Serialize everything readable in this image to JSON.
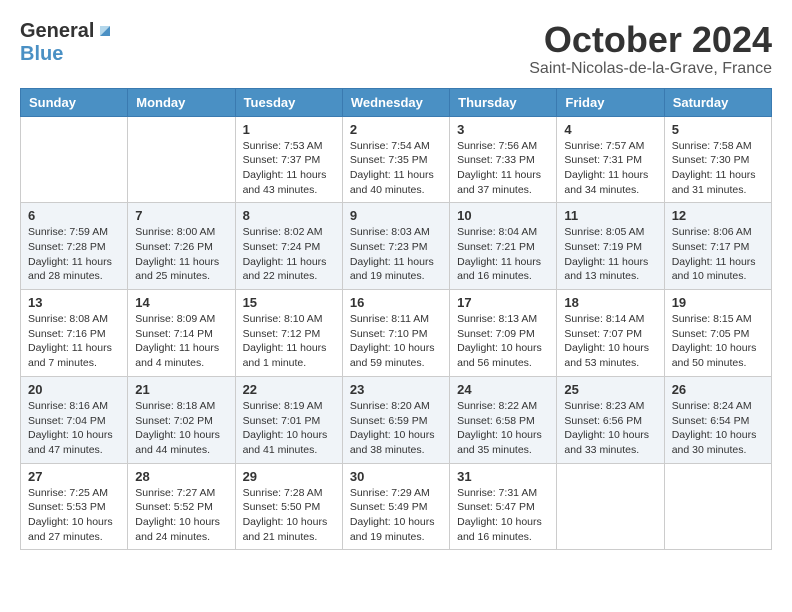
{
  "logo": {
    "general": "General",
    "blue": "Blue"
  },
  "title": "October 2024",
  "location": "Saint-Nicolas-de-la-Grave, France",
  "days_of_week": [
    "Sunday",
    "Monday",
    "Tuesday",
    "Wednesday",
    "Thursday",
    "Friday",
    "Saturday"
  ],
  "weeks": [
    [
      {
        "day": "",
        "info": ""
      },
      {
        "day": "",
        "info": ""
      },
      {
        "day": "1",
        "info": "Sunrise: 7:53 AM\nSunset: 7:37 PM\nDaylight: 11 hours and 43 minutes."
      },
      {
        "day": "2",
        "info": "Sunrise: 7:54 AM\nSunset: 7:35 PM\nDaylight: 11 hours and 40 minutes."
      },
      {
        "day": "3",
        "info": "Sunrise: 7:56 AM\nSunset: 7:33 PM\nDaylight: 11 hours and 37 minutes."
      },
      {
        "day": "4",
        "info": "Sunrise: 7:57 AM\nSunset: 7:31 PM\nDaylight: 11 hours and 34 minutes."
      },
      {
        "day": "5",
        "info": "Sunrise: 7:58 AM\nSunset: 7:30 PM\nDaylight: 11 hours and 31 minutes."
      }
    ],
    [
      {
        "day": "6",
        "info": "Sunrise: 7:59 AM\nSunset: 7:28 PM\nDaylight: 11 hours and 28 minutes."
      },
      {
        "day": "7",
        "info": "Sunrise: 8:00 AM\nSunset: 7:26 PM\nDaylight: 11 hours and 25 minutes."
      },
      {
        "day": "8",
        "info": "Sunrise: 8:02 AM\nSunset: 7:24 PM\nDaylight: 11 hours and 22 minutes."
      },
      {
        "day": "9",
        "info": "Sunrise: 8:03 AM\nSunset: 7:23 PM\nDaylight: 11 hours and 19 minutes."
      },
      {
        "day": "10",
        "info": "Sunrise: 8:04 AM\nSunset: 7:21 PM\nDaylight: 11 hours and 16 minutes."
      },
      {
        "day": "11",
        "info": "Sunrise: 8:05 AM\nSunset: 7:19 PM\nDaylight: 11 hours and 13 minutes."
      },
      {
        "day": "12",
        "info": "Sunrise: 8:06 AM\nSunset: 7:17 PM\nDaylight: 11 hours and 10 minutes."
      }
    ],
    [
      {
        "day": "13",
        "info": "Sunrise: 8:08 AM\nSunset: 7:16 PM\nDaylight: 11 hours and 7 minutes."
      },
      {
        "day": "14",
        "info": "Sunrise: 8:09 AM\nSunset: 7:14 PM\nDaylight: 11 hours and 4 minutes."
      },
      {
        "day": "15",
        "info": "Sunrise: 8:10 AM\nSunset: 7:12 PM\nDaylight: 11 hours and 1 minute."
      },
      {
        "day": "16",
        "info": "Sunrise: 8:11 AM\nSunset: 7:10 PM\nDaylight: 10 hours and 59 minutes."
      },
      {
        "day": "17",
        "info": "Sunrise: 8:13 AM\nSunset: 7:09 PM\nDaylight: 10 hours and 56 minutes."
      },
      {
        "day": "18",
        "info": "Sunrise: 8:14 AM\nSunset: 7:07 PM\nDaylight: 10 hours and 53 minutes."
      },
      {
        "day": "19",
        "info": "Sunrise: 8:15 AM\nSunset: 7:05 PM\nDaylight: 10 hours and 50 minutes."
      }
    ],
    [
      {
        "day": "20",
        "info": "Sunrise: 8:16 AM\nSunset: 7:04 PM\nDaylight: 10 hours and 47 minutes."
      },
      {
        "day": "21",
        "info": "Sunrise: 8:18 AM\nSunset: 7:02 PM\nDaylight: 10 hours and 44 minutes."
      },
      {
        "day": "22",
        "info": "Sunrise: 8:19 AM\nSunset: 7:01 PM\nDaylight: 10 hours and 41 minutes."
      },
      {
        "day": "23",
        "info": "Sunrise: 8:20 AM\nSunset: 6:59 PM\nDaylight: 10 hours and 38 minutes."
      },
      {
        "day": "24",
        "info": "Sunrise: 8:22 AM\nSunset: 6:58 PM\nDaylight: 10 hours and 35 minutes."
      },
      {
        "day": "25",
        "info": "Sunrise: 8:23 AM\nSunset: 6:56 PM\nDaylight: 10 hours and 33 minutes."
      },
      {
        "day": "26",
        "info": "Sunrise: 8:24 AM\nSunset: 6:54 PM\nDaylight: 10 hours and 30 minutes."
      }
    ],
    [
      {
        "day": "27",
        "info": "Sunrise: 7:25 AM\nSunset: 5:53 PM\nDaylight: 10 hours and 27 minutes."
      },
      {
        "day": "28",
        "info": "Sunrise: 7:27 AM\nSunset: 5:52 PM\nDaylight: 10 hours and 24 minutes."
      },
      {
        "day": "29",
        "info": "Sunrise: 7:28 AM\nSunset: 5:50 PM\nDaylight: 10 hours and 21 minutes."
      },
      {
        "day": "30",
        "info": "Sunrise: 7:29 AM\nSunset: 5:49 PM\nDaylight: 10 hours and 19 minutes."
      },
      {
        "day": "31",
        "info": "Sunrise: 7:31 AM\nSunset: 5:47 PM\nDaylight: 10 hours and 16 minutes."
      },
      {
        "day": "",
        "info": ""
      },
      {
        "day": "",
        "info": ""
      }
    ]
  ]
}
